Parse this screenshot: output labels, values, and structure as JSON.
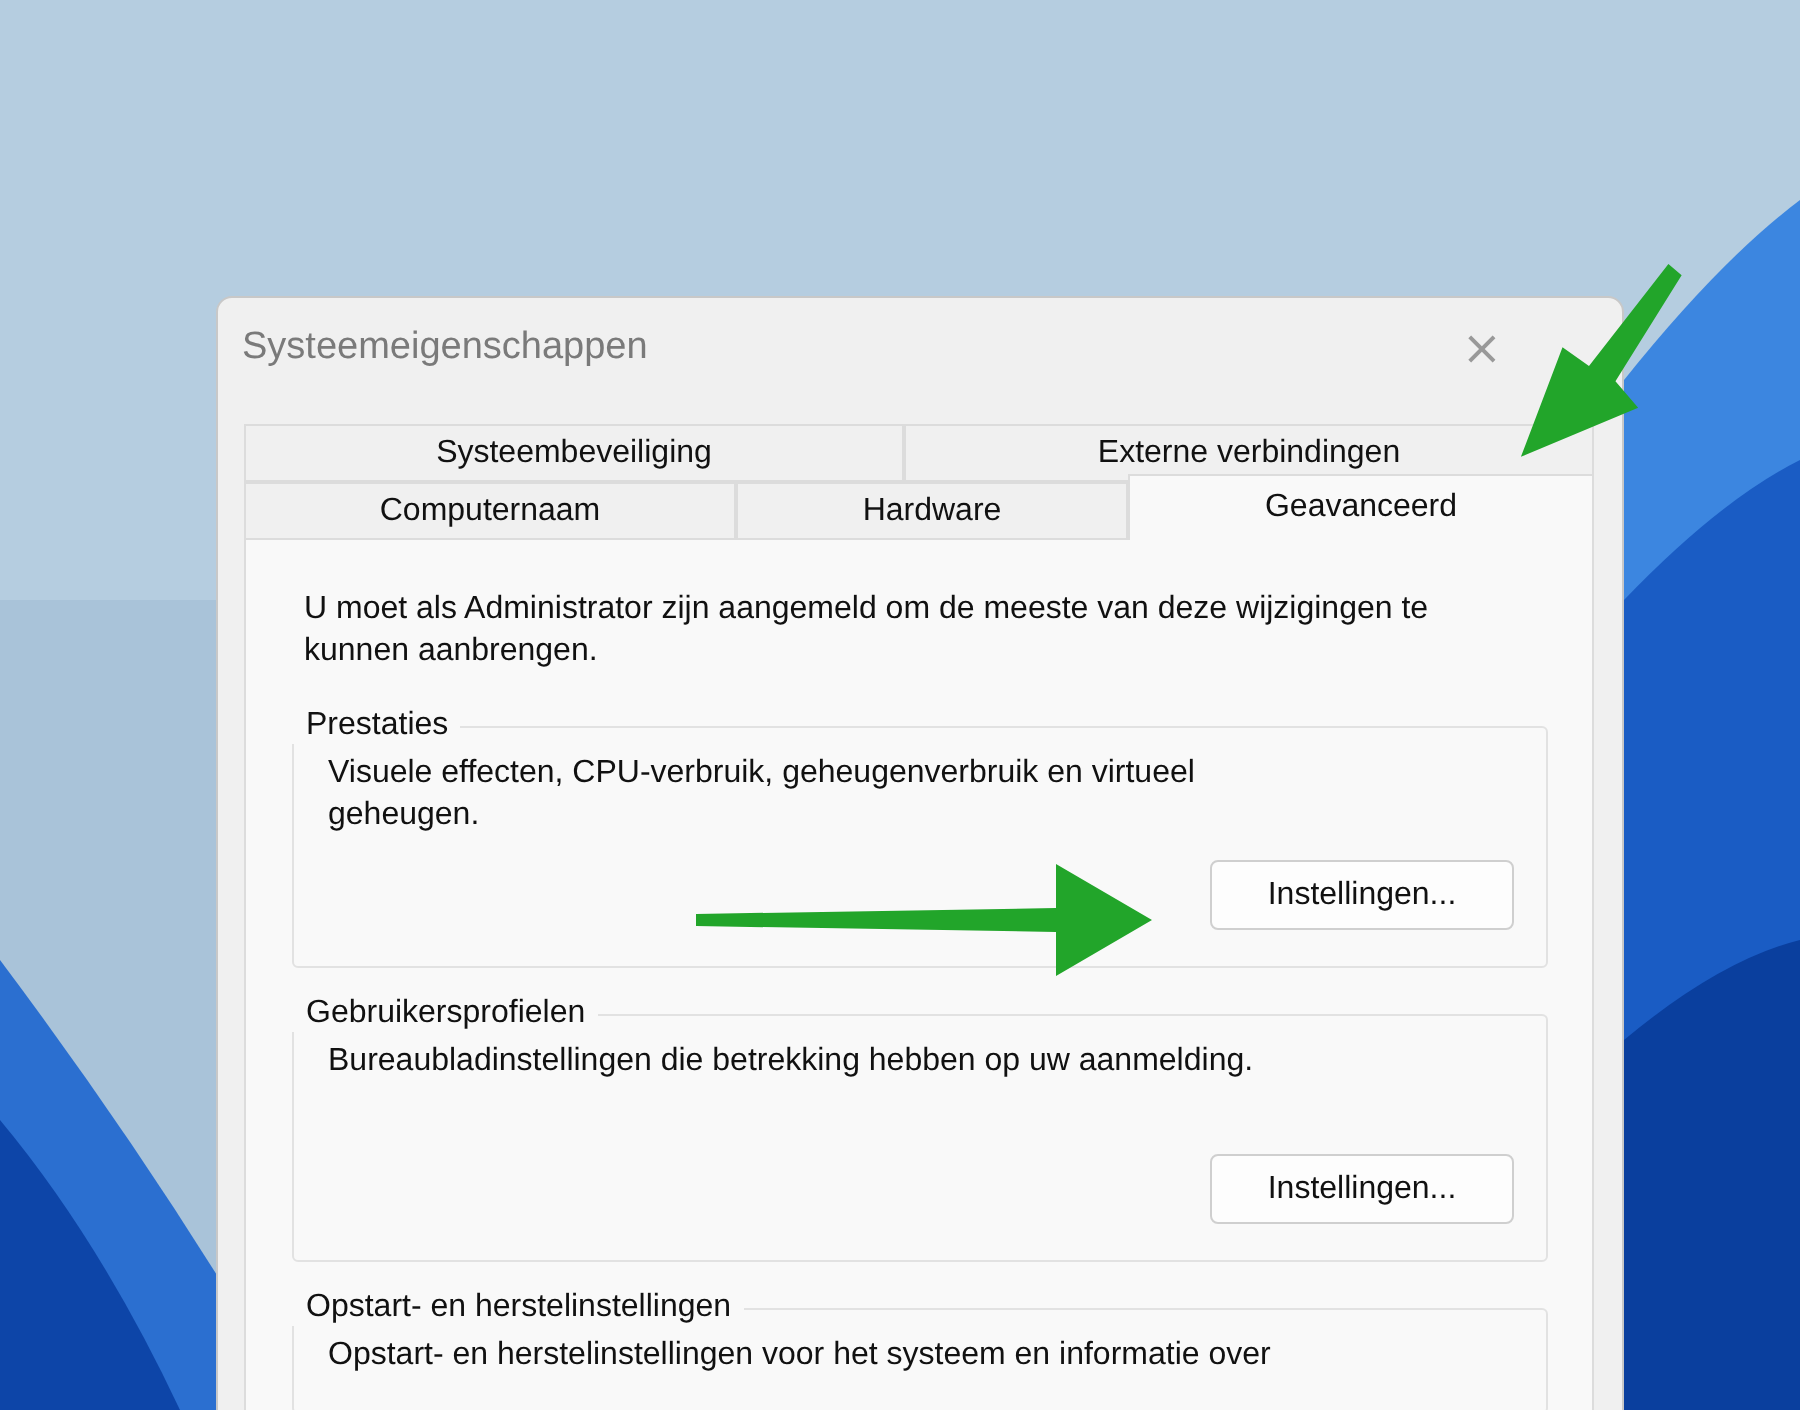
{
  "window": {
    "title": "Systeemeigenschappen",
    "close": "×"
  },
  "tab_rows": [
    [
      {
        "label": "Systeembeveiliging",
        "selected": false
      },
      {
        "label": "Externe verbindingen",
        "selected": false
      }
    ],
    [
      {
        "label": "Computernaam",
        "selected": false
      },
      {
        "label": "Hardware",
        "selected": false
      },
      {
        "label": "Geavanceerd",
        "selected": true
      }
    ]
  ],
  "notice": "U moet als Administrator zijn aangemeld om de meeste van deze wijzigingen te kunnen aanbrengen.",
  "groups": [
    {
      "title": "Prestaties",
      "text": "Visuele effecten, CPU-verbruik, geheugenverbruik en virtueel geheugen.",
      "button": "Instellingen..."
    },
    {
      "title": "Gebruikersprofielen",
      "text": "Bureaubladinstellingen die betrekking hebben op uw aanmelding.",
      "button": "Instellingen..."
    },
    {
      "title": "Opstart- en herstelinstellingen",
      "text": "Opstart- en herstelinstellingen voor het systeem en informatie over"
    }
  ]
}
